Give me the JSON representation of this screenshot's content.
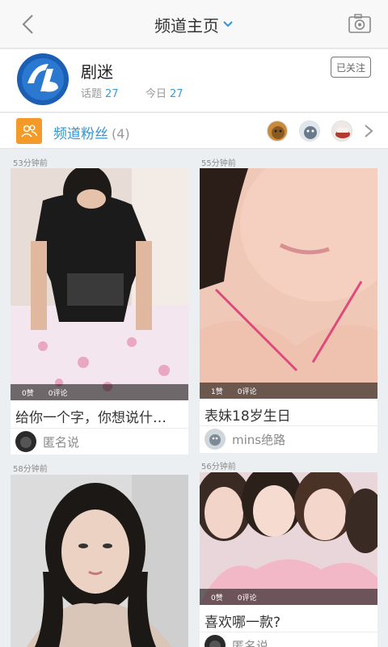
{
  "header": {
    "title": "频道主页",
    "back_icon": "chevron-left-icon",
    "dropdown_icon": "chevron-down-icon",
    "camera_icon": "camera-icon"
  },
  "channel": {
    "name": "剧迷",
    "topics_label": "话题",
    "topics_value": "27",
    "today_label": "今日",
    "today_value": "27",
    "follow_label": "已关注",
    "logo_icon": "channel-logo-icon"
  },
  "fans": {
    "label": "频道粉丝",
    "count": "(4)",
    "icon": "people-icon",
    "more_icon": "chevron-right-icon"
  },
  "posts": [
    {
      "time": "53分钟前",
      "likes": "0赞",
      "comments": "0评论",
      "caption": "给你一个字，你想说什…",
      "author": "匿名说"
    },
    {
      "time": "55分钟前",
      "likes": "1赞",
      "comments": "0评论",
      "caption": "表妹18岁生日",
      "author": "mins绝路"
    },
    {
      "time": "58分钟前"
    },
    {
      "time": "56分钟前",
      "likes": "0赞",
      "comments": "0评论",
      "caption": "喜欢哪一款?",
      "author": "匿名说"
    }
  ],
  "colors": {
    "accent_blue": "#2e96d6",
    "fans_orange": "#f39a28",
    "stat_blue": "#3a9bd8"
  }
}
